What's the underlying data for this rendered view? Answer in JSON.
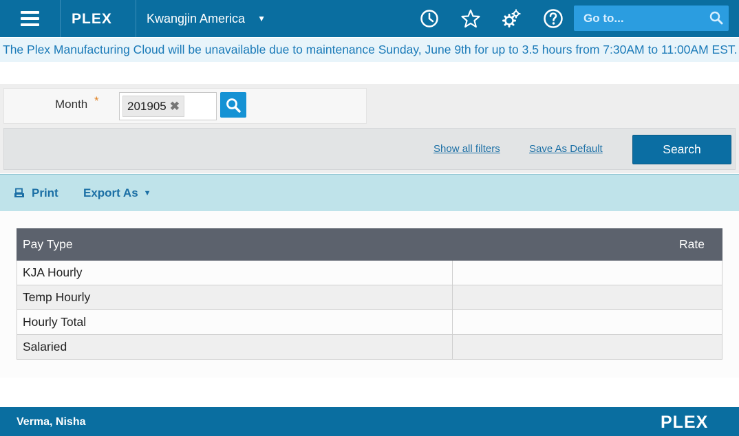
{
  "header": {
    "logo_text": "PLEX",
    "company": "Kwangjin America",
    "goto_placeholder": "Go to...",
    "icons": [
      "hamburger-menu-icon",
      "clock-icon",
      "star-icon",
      "gears-icon",
      "help-icon",
      "search-icon"
    ]
  },
  "banner": {
    "message": "The Plex Manufacturing Cloud will be unavailable due to maintenance Sunday, June 9th for up to 3.5 hours from 7:30AM to 11:00AM EST."
  },
  "filters": {
    "month_label": "Month",
    "required_mark": "*",
    "month_value": "201905",
    "remove_glyph": "✖",
    "show_all_filters": "Show all filters",
    "save_as_default": "Save As Default",
    "search_button": "Search"
  },
  "toolbar": {
    "print_label": "Print",
    "export_label": "Export As"
  },
  "table": {
    "columns": [
      "Pay Type",
      "Rate"
    ],
    "rows": [
      {
        "pay_type": "KJA Hourly",
        "rate": ""
      },
      {
        "pay_type": "Temp Hourly",
        "rate": ""
      },
      {
        "pay_type": "Hourly Total",
        "rate": ""
      },
      {
        "pay_type": "Salaried",
        "rate": ""
      }
    ]
  },
  "footer": {
    "user_name": "Verma, Nisha",
    "logo_text": "PLEX"
  },
  "colors": {
    "brand_blue": "#0a6ea0",
    "accent_blue": "#2b9de0",
    "banner_text": "#1a7ab8",
    "toolbar_bg": "#bfe3ea",
    "table_header": "#5c626d",
    "required_orange": "#e08020"
  }
}
